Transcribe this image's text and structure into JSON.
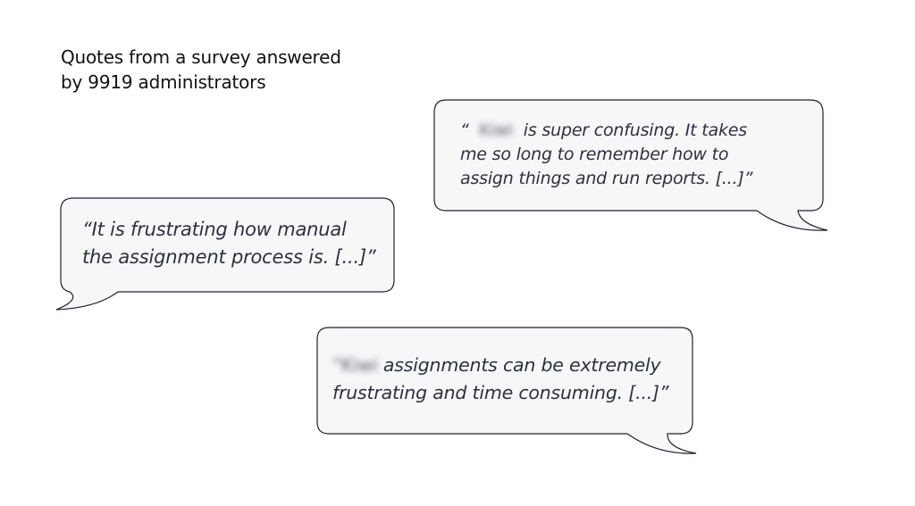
{
  "intro": {
    "line1": "Quotes from a survey answered",
    "line2": "by 9919 administrators"
  },
  "quotes": [
    {
      "open": "“",
      "redacted": "Kiwi",
      "lines": [
        "is super confusing. It takes",
        "me so long to remember how to",
        "assign things and run reports. [...]”"
      ]
    },
    {
      "lines": [
        "“It is frustrating how manual",
        "the assignment process is. [...]”"
      ]
    },
    {
      "redacted": "“Kiwi",
      "lines": [
        "assignments can be extremely",
        "frustrating and time consuming. [...]”"
      ]
    }
  ],
  "colors": {
    "bubble_fill": "#f7f7f8",
    "bubble_stroke": "#1e2233",
    "quote_text": "#2b3142",
    "intro_text": "#111111"
  }
}
